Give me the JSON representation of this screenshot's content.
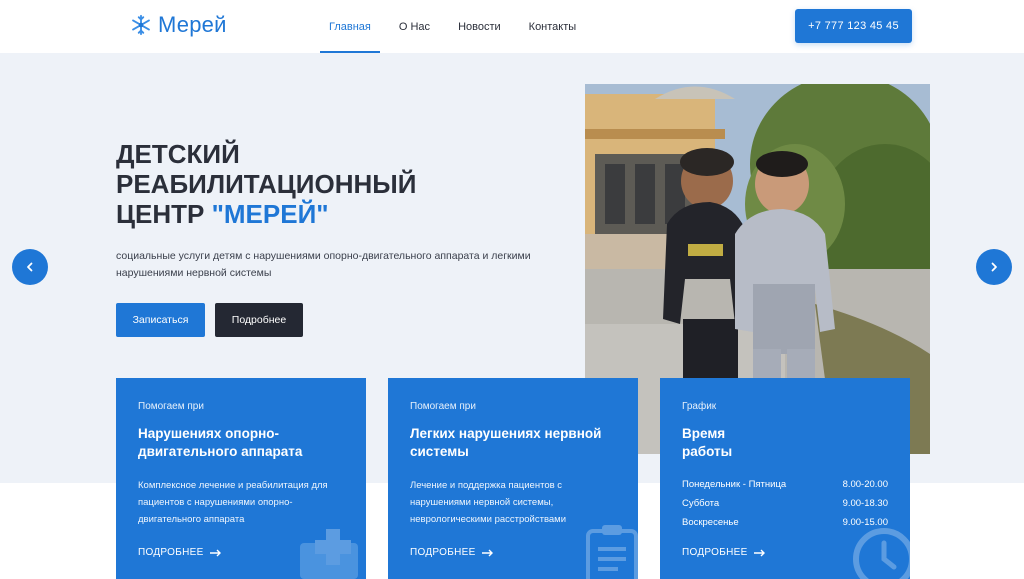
{
  "brand": {
    "name": "Мерей",
    "color": "#1f77d6"
  },
  "nav": {
    "items": [
      {
        "label": "Главная",
        "active": true
      },
      {
        "label": "О Нас",
        "active": false
      },
      {
        "label": "Новости",
        "active": false
      },
      {
        "label": "Контакты",
        "active": false
      }
    ],
    "phone": "+7 777 123 45 45"
  },
  "hero": {
    "title_line1": "Детский",
    "title_line2": "реабилитационный",
    "title_line3_prefix": "центр ",
    "title_accent": "\"Мерей\"",
    "subtitle": "социальные услуги детям с нарушениями опорно-двигательного аппарата и легкими нарушениями нервной системы",
    "primary_button": "Записаться",
    "secondary_button": "Подробнее",
    "prev_icon": "chevron-left-icon",
    "next_icon": "chevron-right-icon"
  },
  "cards": [
    {
      "kicker": "Помогаем при",
      "title": "Нарушениях опорно-двигательного аппарата",
      "text": "Комплексное лечение и реабилитация для пациентов с нарушениями опорно-двигательного аппарата",
      "more": "ПОДРОБНЕЕ",
      "icon": "ambulance-icon"
    },
    {
      "kicker": "Помогаем при",
      "title": "Легких нарушениях нервной системы",
      "text": "Лечение и поддержка пациентов с нарушениями нервной системы, неврологическими расстройствами",
      "more": "ПОДРОБНЕЕ",
      "icon": "clipboard-icon"
    },
    {
      "kicker": "График",
      "title_line1": "Время",
      "title_line2": "работы",
      "schedule": [
        {
          "day": "Понедельник - Пятница",
          "hours": "8.00-20.00"
        },
        {
          "day": "Суббота",
          "hours": "9.00-18.30"
        },
        {
          "day": "Воскресенье",
          "hours": "9.00-15.00"
        }
      ],
      "more": "ПОДРОБНЕЕ",
      "icon": "clock-icon"
    }
  ]
}
